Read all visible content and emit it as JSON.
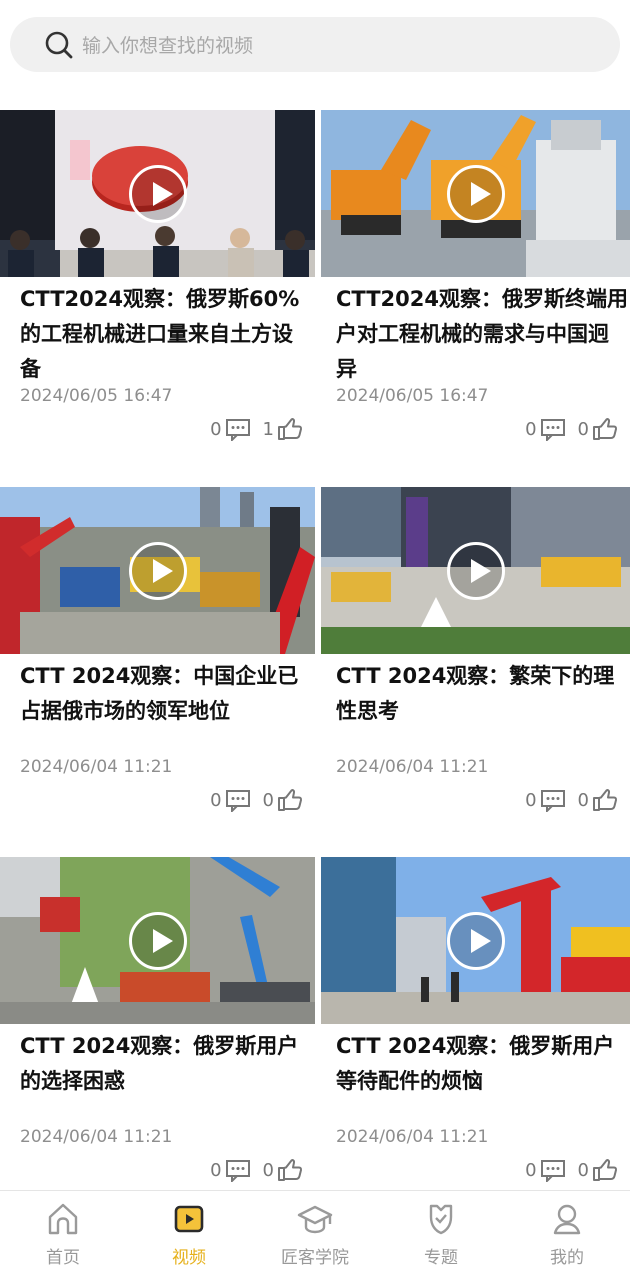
{
  "search": {
    "placeholder": "输入你想查找的视频"
  },
  "videos": [
    {
      "title": "CTT2024观察：俄罗斯60%的工程机械进口量来自土方设备",
      "date": "2024/06/05 16:47",
      "comments": "0",
      "likes": "1"
    },
    {
      "title": "CTT2024观察：俄罗斯终端用户对工程机械的需求与中国迥异",
      "date": "2024/06/05 16:47",
      "comments": "0",
      "likes": "0"
    },
    {
      "title": "CTT 2024观察：中国企业已占据俄市场的领军地位",
      "date": "2024/06/04 11:21",
      "comments": "0",
      "likes": "0"
    },
    {
      "title": "CTT 2024观察：繁荣下的理性思考",
      "date": "2024/06/04 11:21",
      "comments": "0",
      "likes": "0"
    },
    {
      "title": "CTT 2024观察：俄罗斯用户的选择困惑",
      "date": "2024/06/04 11:21",
      "comments": "0",
      "likes": "0"
    },
    {
      "title": "CTT 2024观察：俄罗斯用户等待配件的烦恼",
      "date": "2024/06/04 11:21",
      "comments": "0",
      "likes": "0"
    }
  ],
  "tabs": [
    {
      "label": "首页",
      "icon": "home-icon"
    },
    {
      "label": "视频",
      "icon": "video-icon"
    },
    {
      "label": "匠客学院",
      "icon": "graduation-cap-icon"
    },
    {
      "label": "专题",
      "icon": "badge-icon"
    },
    {
      "label": "我的",
      "icon": "user-icon"
    }
  ],
  "colors": {
    "accent": "#e6b11c",
    "muted": "#999999",
    "search_bg": "#f0f0f0"
  }
}
